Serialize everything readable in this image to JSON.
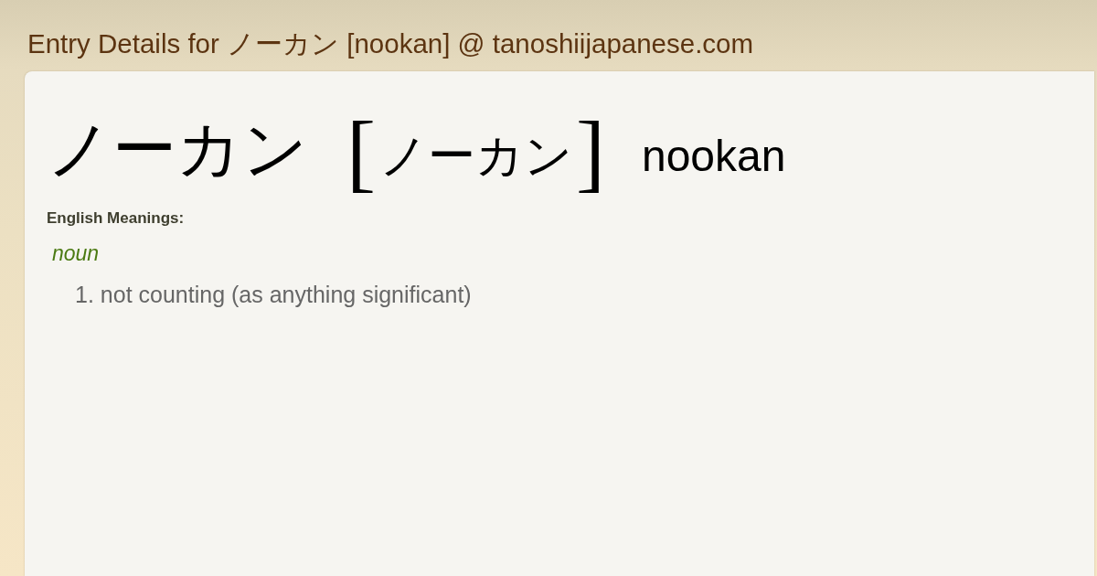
{
  "page_title": "Entry Details for ノーカン [nookan] @ tanoshiijapanese.com",
  "entry": {
    "word": "ノーカン",
    "reading": {
      "open_bracket": "[",
      "text": "ノーカン",
      "close_bracket": "]"
    },
    "romaji": "nookan"
  },
  "meanings": {
    "heading": "English Meanings:",
    "groups": [
      {
        "part_of_speech": "noun",
        "senses": [
          {
            "number": "1.",
            "text": "not counting (as anything significant)"
          }
        ]
      }
    ]
  }
}
